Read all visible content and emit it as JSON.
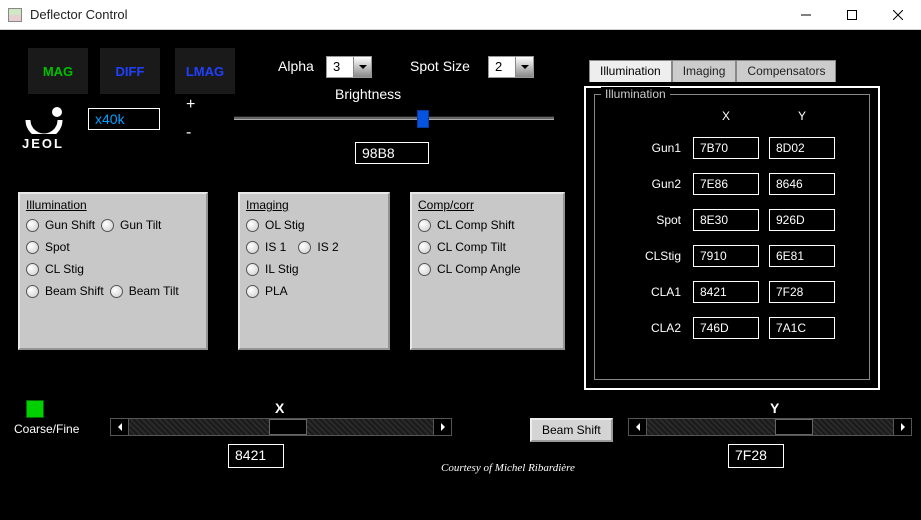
{
  "window": {
    "title": "Deflector Control"
  },
  "modes": {
    "mag": "MAG",
    "diff": "DIFF",
    "lmag": "LMAG"
  },
  "logo": {
    "brand": "JEOL",
    "mag_value": "x40k"
  },
  "alpha": {
    "label": "Alpha",
    "value": "3"
  },
  "spot_size": {
    "label": "Spot Size",
    "value": "2"
  },
  "brightness": {
    "label": "Brightness",
    "value": "98B8",
    "plus": "+",
    "minus": "-"
  },
  "panels": {
    "illumination": {
      "title": "Illumination",
      "options": [
        "Gun Shift",
        "Gun Tilt",
        "Spot",
        "CL Stig",
        "Beam Shift",
        "Beam Tilt"
      ]
    },
    "imaging": {
      "title": "Imaging",
      "options": [
        "OL Stig",
        "IS 1",
        "IS 2",
        "IL Stig",
        "PLA"
      ]
    },
    "comp": {
      "title": "Comp/corr",
      "options": [
        "CL Comp Shift",
        "CL Comp Tilt",
        "CL Comp Angle"
      ]
    }
  },
  "tabs": {
    "items": [
      "Illumination",
      "Imaging",
      "Compensators"
    ],
    "fieldset_title": "Illumination",
    "col_x": "X",
    "col_y": "Y",
    "rows": [
      {
        "label": "Gun1",
        "x": "7B70",
        "y": "8D02"
      },
      {
        "label": "Gun2",
        "x": "7E86",
        "y": "8646"
      },
      {
        "label": "Spot",
        "x": "8E30",
        "y": "926D"
      },
      {
        "label": "CLStig",
        "x": "7910",
        "y": "6E81"
      },
      {
        "label": "CLA1",
        "x": "8421",
        "y": "7F28"
      },
      {
        "label": "CLA2",
        "x": "746D",
        "y": "7A1C"
      }
    ]
  },
  "bottom": {
    "coarse_fine": "Coarse/Fine",
    "x_label": "X",
    "y_label": "Y",
    "center_button": "Beam Shift",
    "x_value": "8421",
    "y_value": "7F28",
    "credit": "Courtesy of Michel Ribardière"
  }
}
